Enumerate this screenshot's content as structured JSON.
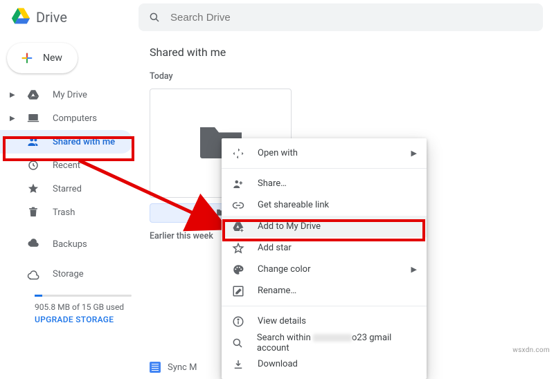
{
  "header": {
    "app_name": "Drive",
    "search_placeholder": "Search Drive"
  },
  "sidebar": {
    "new_label": "New",
    "items": [
      {
        "label": "My Drive"
      },
      {
        "label": "Computers"
      },
      {
        "label": "Shared with me"
      },
      {
        "label": "Recent"
      },
      {
        "label": "Starred"
      },
      {
        "label": "Trash"
      },
      {
        "label": "Backups"
      }
    ],
    "storage": {
      "title": "Storage",
      "used_label": "905.8 MB of 15 GB used",
      "upgrade_label": "UPGRADE STORAGE"
    }
  },
  "main": {
    "page_title": "Shared with me",
    "section_today": "Today",
    "section_earlier": "Earlier this week",
    "doc_label": "Sync M"
  },
  "context_menu": {
    "open_with": "Open with",
    "share": "Share…",
    "get_link": "Get shareable link",
    "add_to_drive": "Add to My Drive",
    "add_star": "Add star",
    "change_color": "Change color",
    "rename": "Rename…",
    "view_details": "View details",
    "search_within_suffix": "o23 gmail account",
    "search_within_prefix": "Search within ",
    "download": "Download"
  },
  "watermark": "wsxdn.com"
}
